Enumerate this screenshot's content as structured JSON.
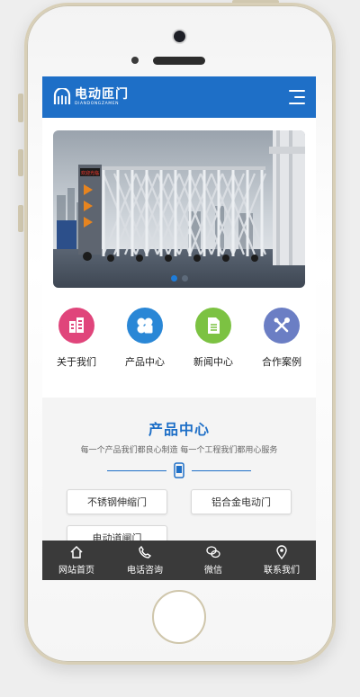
{
  "header": {
    "logo_cn": "电动匝门",
    "logo_en": "DIANDONGZAMEN",
    "menu_icon": "hamburger-menu-icon",
    "color": "#1e6fc7"
  },
  "banner": {
    "image": "retractable-electric-gate-photo",
    "sign_text": "欢迎光临",
    "slides": 2,
    "active_slide": 1
  },
  "quick_links": [
    {
      "label": "关于我们",
      "icon": "building-icon",
      "color": "#e0457b"
    },
    {
      "label": "产品中心",
      "icon": "grid-icon",
      "color": "#2a87d6"
    },
    {
      "label": "新闻中心",
      "icon": "document-icon",
      "color": "#7cc242"
    },
    {
      "label": "合作案例",
      "icon": "tools-icon",
      "color": "#6b7ec4"
    }
  ],
  "products": {
    "title": "产品中心",
    "subtitle": "每一个产品我们都良心制造 每一个工程我们都用心服务",
    "categories": [
      "不锈钢伸缩门",
      "铝合金电动门",
      "电动道闸门"
    ]
  },
  "tabbar": [
    {
      "label": "网站首页",
      "icon": "home-icon"
    },
    {
      "label": "电话咨询",
      "icon": "phone-icon"
    },
    {
      "label": "微信",
      "icon": "wechat-icon"
    },
    {
      "label": "联系我们",
      "icon": "location-icon"
    }
  ]
}
